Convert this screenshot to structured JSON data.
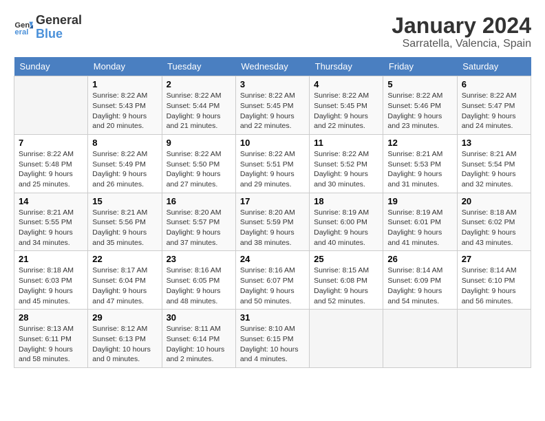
{
  "header": {
    "logo_line1": "General",
    "logo_line2": "Blue",
    "month_title": "January 2024",
    "location": "Sarratella, Valencia, Spain"
  },
  "days_of_week": [
    "Sunday",
    "Monday",
    "Tuesday",
    "Wednesday",
    "Thursday",
    "Friday",
    "Saturday"
  ],
  "weeks": [
    [
      {
        "day": "",
        "info": ""
      },
      {
        "day": "1",
        "info": "Sunrise: 8:22 AM\nSunset: 5:43 PM\nDaylight: 9 hours\nand 20 minutes."
      },
      {
        "day": "2",
        "info": "Sunrise: 8:22 AM\nSunset: 5:44 PM\nDaylight: 9 hours\nand 21 minutes."
      },
      {
        "day": "3",
        "info": "Sunrise: 8:22 AM\nSunset: 5:45 PM\nDaylight: 9 hours\nand 22 minutes."
      },
      {
        "day": "4",
        "info": "Sunrise: 8:22 AM\nSunset: 5:45 PM\nDaylight: 9 hours\nand 22 minutes."
      },
      {
        "day": "5",
        "info": "Sunrise: 8:22 AM\nSunset: 5:46 PM\nDaylight: 9 hours\nand 23 minutes."
      },
      {
        "day": "6",
        "info": "Sunrise: 8:22 AM\nSunset: 5:47 PM\nDaylight: 9 hours\nand 24 minutes."
      }
    ],
    [
      {
        "day": "7",
        "info": "Sunrise: 8:22 AM\nSunset: 5:48 PM\nDaylight: 9 hours\nand 25 minutes."
      },
      {
        "day": "8",
        "info": "Sunrise: 8:22 AM\nSunset: 5:49 PM\nDaylight: 9 hours\nand 26 minutes."
      },
      {
        "day": "9",
        "info": "Sunrise: 8:22 AM\nSunset: 5:50 PM\nDaylight: 9 hours\nand 27 minutes."
      },
      {
        "day": "10",
        "info": "Sunrise: 8:22 AM\nSunset: 5:51 PM\nDaylight: 9 hours\nand 29 minutes."
      },
      {
        "day": "11",
        "info": "Sunrise: 8:22 AM\nSunset: 5:52 PM\nDaylight: 9 hours\nand 30 minutes."
      },
      {
        "day": "12",
        "info": "Sunrise: 8:21 AM\nSunset: 5:53 PM\nDaylight: 9 hours\nand 31 minutes."
      },
      {
        "day": "13",
        "info": "Sunrise: 8:21 AM\nSunset: 5:54 PM\nDaylight: 9 hours\nand 32 minutes."
      }
    ],
    [
      {
        "day": "14",
        "info": "Sunrise: 8:21 AM\nSunset: 5:55 PM\nDaylight: 9 hours\nand 34 minutes."
      },
      {
        "day": "15",
        "info": "Sunrise: 8:21 AM\nSunset: 5:56 PM\nDaylight: 9 hours\nand 35 minutes."
      },
      {
        "day": "16",
        "info": "Sunrise: 8:20 AM\nSunset: 5:57 PM\nDaylight: 9 hours\nand 37 minutes."
      },
      {
        "day": "17",
        "info": "Sunrise: 8:20 AM\nSunset: 5:59 PM\nDaylight: 9 hours\nand 38 minutes."
      },
      {
        "day": "18",
        "info": "Sunrise: 8:19 AM\nSunset: 6:00 PM\nDaylight: 9 hours\nand 40 minutes."
      },
      {
        "day": "19",
        "info": "Sunrise: 8:19 AM\nSunset: 6:01 PM\nDaylight: 9 hours\nand 41 minutes."
      },
      {
        "day": "20",
        "info": "Sunrise: 8:18 AM\nSunset: 6:02 PM\nDaylight: 9 hours\nand 43 minutes."
      }
    ],
    [
      {
        "day": "21",
        "info": "Sunrise: 8:18 AM\nSunset: 6:03 PM\nDaylight: 9 hours\nand 45 minutes."
      },
      {
        "day": "22",
        "info": "Sunrise: 8:17 AM\nSunset: 6:04 PM\nDaylight: 9 hours\nand 47 minutes."
      },
      {
        "day": "23",
        "info": "Sunrise: 8:16 AM\nSunset: 6:05 PM\nDaylight: 9 hours\nand 48 minutes."
      },
      {
        "day": "24",
        "info": "Sunrise: 8:16 AM\nSunset: 6:07 PM\nDaylight: 9 hours\nand 50 minutes."
      },
      {
        "day": "25",
        "info": "Sunrise: 8:15 AM\nSunset: 6:08 PM\nDaylight: 9 hours\nand 52 minutes."
      },
      {
        "day": "26",
        "info": "Sunrise: 8:14 AM\nSunset: 6:09 PM\nDaylight: 9 hours\nand 54 minutes."
      },
      {
        "day": "27",
        "info": "Sunrise: 8:14 AM\nSunset: 6:10 PM\nDaylight: 9 hours\nand 56 minutes."
      }
    ],
    [
      {
        "day": "28",
        "info": "Sunrise: 8:13 AM\nSunset: 6:11 PM\nDaylight: 9 hours\nand 58 minutes."
      },
      {
        "day": "29",
        "info": "Sunrise: 8:12 AM\nSunset: 6:13 PM\nDaylight: 10 hours\nand 0 minutes."
      },
      {
        "day": "30",
        "info": "Sunrise: 8:11 AM\nSunset: 6:14 PM\nDaylight: 10 hours\nand 2 minutes."
      },
      {
        "day": "31",
        "info": "Sunrise: 8:10 AM\nSunset: 6:15 PM\nDaylight: 10 hours\nand 4 minutes."
      },
      {
        "day": "",
        "info": ""
      },
      {
        "day": "",
        "info": ""
      },
      {
        "day": "",
        "info": ""
      }
    ]
  ]
}
